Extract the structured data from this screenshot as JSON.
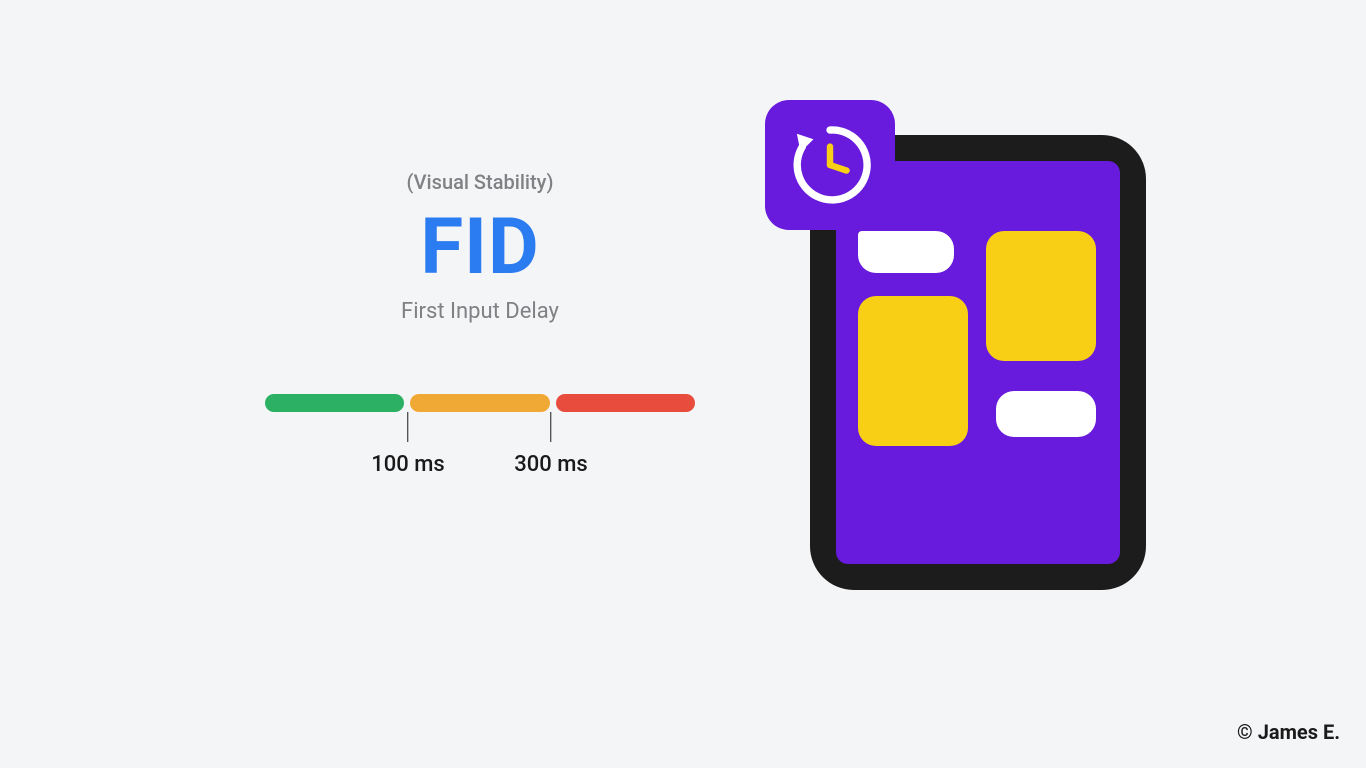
{
  "left": {
    "visual_stability": "(Visual Stability)",
    "title": "FID",
    "subtitle": "First Input Delay",
    "scale": {
      "threshold_1_label": "100 ms",
      "threshold_2_label": "300 ms",
      "colors": {
        "good": "#2cb164",
        "medium": "#f0a935",
        "poor": "#e74c3c"
      }
    }
  },
  "credit": "© James E.",
  "colors": {
    "background": "#f4f5f7",
    "accent_blue": "#2a7cf0",
    "phone_body": "#1c1c1c",
    "phone_screen": "#681bdd",
    "card_yellow": "#f9cf15",
    "card_white": "#ffffff",
    "clock_badge": "#681bdd"
  }
}
